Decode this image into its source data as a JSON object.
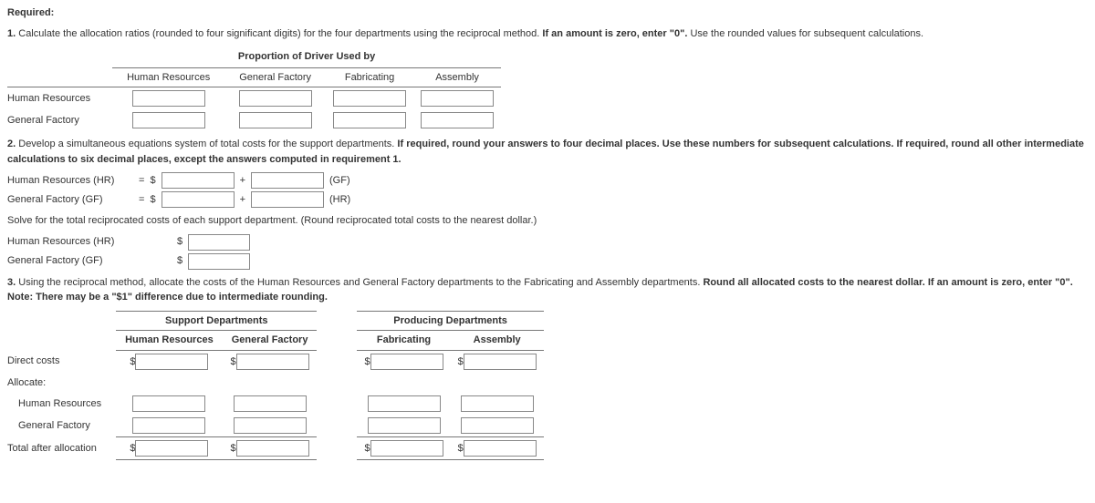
{
  "required_label": "Required:",
  "q1": {
    "prefix": "1.",
    "text": "Calculate the allocation ratios (rounded to four significant digits) for the four departments using the reciprocal method.",
    "bold1": "If an amount is zero, enter \"0\".",
    "tail": "Use the rounded values for subsequent calculations."
  },
  "table1": {
    "title": "Proportion of Driver Used by",
    "cols": [
      "Human Resources",
      "General Factory",
      "Fabricating",
      "Assembly"
    ],
    "rows": [
      "Human Resources",
      "General Factory"
    ]
  },
  "q2": {
    "prefix": "2.",
    "text1": "Develop a simultaneous equations system of total costs for the support departments.",
    "bold1": "If required, round your answers to four decimal places. Use these numbers for subsequent calculations. If required, round all other intermediate calculations to six decimal places, except the answers computed in requirement 1."
  },
  "eqs": {
    "hr_label": "Human Resources (HR)",
    "gf_label": "General Factory (GF)",
    "eq": "=",
    "dollar": "$",
    "plus": "+",
    "gf_suffix": "(GF)",
    "hr_suffix": "(HR)"
  },
  "solve_text": "Solve for the total reciprocated costs of each support department. (Round reciprocated total costs to the nearest dollar.)",
  "q3": {
    "prefix": "3.",
    "text1": "Using the reciprocal method, allocate the costs of the Human Resources and General Factory departments to the Fabricating and Assembly departments.",
    "bold1": "Round all allocated costs to the nearest dollar. If an amount is zero, enter \"0\". Note: There may be a \"$1\" difference due to intermediate rounding."
  },
  "table3": {
    "group1": "Support Departments",
    "group2": "Producing Departments",
    "cols": [
      "Human Resources",
      "General Factory",
      "Fabricating",
      "Assembly"
    ],
    "rows": {
      "direct": "Direct costs",
      "allocate": "Allocate:",
      "hr": "Human Resources",
      "gf": "General Factory",
      "total": "Total after allocation"
    }
  }
}
